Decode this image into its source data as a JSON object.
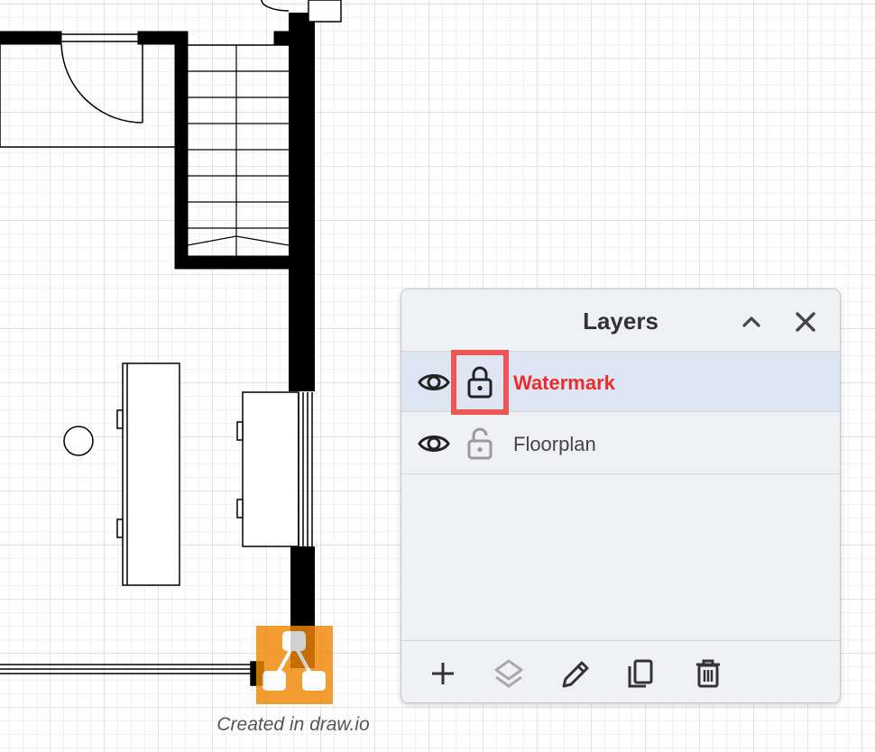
{
  "caption": "Created in draw.io",
  "layers_panel": {
    "title": "Layers",
    "collapse_icon": "chevron-up-icon",
    "close_icon": "close-icon",
    "selected_layer": "Watermark",
    "layers": [
      {
        "name": "Watermark",
        "visible": true,
        "locked": true,
        "selected": true
      },
      {
        "name": "Floorplan",
        "visible": true,
        "locked": false,
        "selected": false
      }
    ],
    "toolbar": [
      {
        "icon": "plus-icon",
        "action": "add-layer"
      },
      {
        "icon": "layers-icon",
        "action": "move-selection"
      },
      {
        "icon": "pencil-icon",
        "action": "edit-data"
      },
      {
        "icon": "duplicate-icon",
        "action": "duplicate"
      },
      {
        "icon": "trash-icon",
        "action": "delete"
      }
    ]
  },
  "colors": {
    "selected_row": "#dfe6f3",
    "selected_text": "#ee2b2b",
    "highlight_border": "#ee5555",
    "logo_orange": "#f08705"
  }
}
